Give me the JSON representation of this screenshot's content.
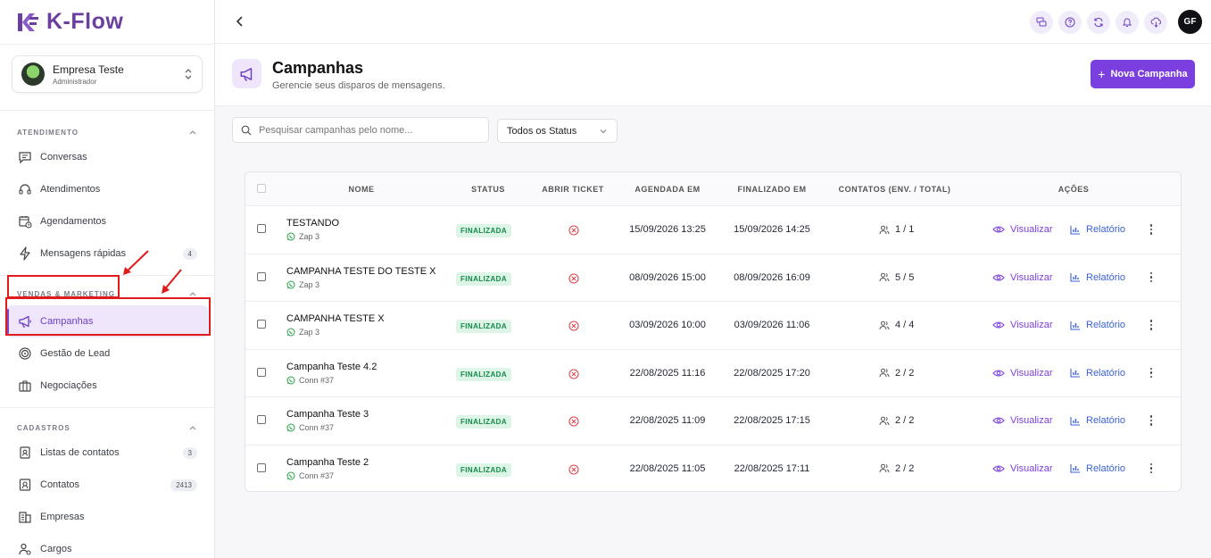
{
  "app": {
    "name": "K-Flow",
    "brand_color": "#7b3fe0"
  },
  "company": {
    "name": "Empresa Teste",
    "role": "Administrador"
  },
  "sidebar": {
    "sections": [
      {
        "title": "ATENDIMENTO",
        "items": [
          {
            "label": "Conversas",
            "icon": "chat-icon",
            "badge": ""
          },
          {
            "label": "Atendimentos",
            "icon": "headset-icon",
            "badge": ""
          },
          {
            "label": "Agendamentos",
            "icon": "calendar-clock-icon",
            "badge": ""
          },
          {
            "label": "Mensagens rápidas",
            "icon": "lightning-icon",
            "badge": "4"
          }
        ]
      },
      {
        "title": "VENDAS & MARKETING",
        "items": [
          {
            "label": "Campanhas",
            "icon": "megaphone-icon",
            "badge": "",
            "active": true
          },
          {
            "label": "Gestão de Lead",
            "icon": "target-icon",
            "badge": ""
          },
          {
            "label": "Negociações",
            "icon": "briefcase-icon",
            "badge": ""
          }
        ]
      },
      {
        "title": "CADASTROS",
        "items": [
          {
            "label": "Listas de contatos",
            "icon": "contact-book-icon",
            "badge": "3"
          },
          {
            "label": "Contatos",
            "icon": "contact-card-icon",
            "badge": "2413"
          },
          {
            "label": "Empresas",
            "icon": "building-icon",
            "badge": ""
          },
          {
            "label": "Cargos",
            "icon": "user-role-icon",
            "badge": ""
          }
        ]
      }
    ]
  },
  "topbar": {
    "avatar_initials": "GF",
    "icons": [
      "chat-bubbles-icon",
      "help-icon",
      "refresh-icon",
      "bell-icon",
      "cloud-download-icon"
    ]
  },
  "page": {
    "title": "Campanhas",
    "subtitle": "Gerencie seus disparos de mensagens.",
    "new_button": "Nova Campanha"
  },
  "filters": {
    "search_placeholder": "Pesquisar campanhas pelo nome...",
    "status_selected": "Todos os Status"
  },
  "table": {
    "columns": [
      "NOME",
      "STATUS",
      "ABRIR TICKET",
      "AGENDADA EM",
      "FINALIZADO EM",
      "CONTATOS (ENV. / TOTAL)",
      "AÇÕES"
    ],
    "action_view": "Visualizar",
    "action_report": "Relatório",
    "rows": [
      {
        "name": "TESTANDO",
        "connection": "Zap 3",
        "status": "FINALIZADA",
        "scheduled": "15/09/2026 13:25",
        "finished": "15/09/2026 14:25",
        "contacts": "1 / 1"
      },
      {
        "name": "CAMPANHA TESTE DO TESTE X",
        "connection": "Zap 3",
        "status": "FINALIZADA",
        "scheduled": "08/09/2026 15:00",
        "finished": "08/09/2026 16:09",
        "contacts": "5 / 5"
      },
      {
        "name": "CAMPANHA TESTE X",
        "connection": "Zap 3",
        "status": "FINALIZADA",
        "scheduled": "03/09/2026 10:00",
        "finished": "03/09/2026 11:06",
        "contacts": "4 / 4"
      },
      {
        "name": "Campanha Teste 4.2",
        "connection": "Conn #37",
        "status": "FINALIZADA",
        "scheduled": "22/08/2025 11:16",
        "finished": "22/08/2025 17:20",
        "contacts": "2 / 2"
      },
      {
        "name": "Campanha Teste 3",
        "connection": "Conn #37",
        "status": "FINALIZADA",
        "scheduled": "22/08/2025 11:09",
        "finished": "22/08/2025 17:15",
        "contacts": "2 / 2"
      },
      {
        "name": "Campanha Teste 2",
        "connection": "Conn #37",
        "status": "FINALIZADA",
        "scheduled": "22/08/2025 11:05",
        "finished": "22/08/2025 17:11",
        "contacts": "2 / 2"
      }
    ]
  },
  "annotation_color": "#e01b1b"
}
